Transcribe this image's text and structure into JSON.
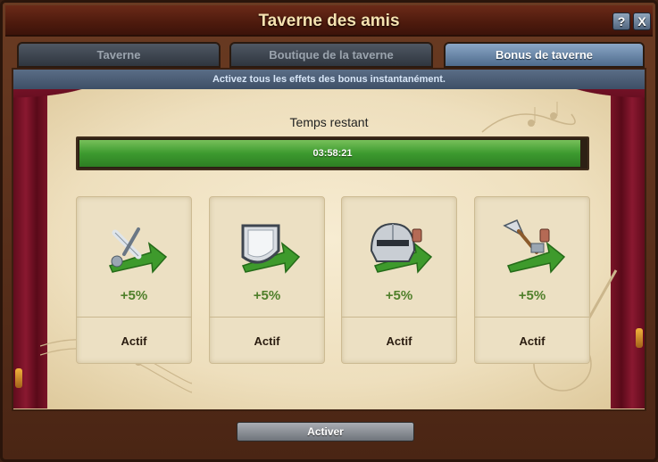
{
  "window": {
    "title": "Taverne des amis",
    "help_label": "?",
    "close_label": "X"
  },
  "tabs": [
    {
      "label": "Taverne",
      "active": false
    },
    {
      "label": "Boutique de la taverne",
      "active": false
    },
    {
      "label": "Bonus de taverne",
      "active": true
    }
  ],
  "info_text": "Activez tous les effets des bonus instantanément.",
  "timer": {
    "label": "Temps restant",
    "value": "03:58:21",
    "progress": 0.99
  },
  "bonuses": [
    {
      "icon": "sword-arrow-icon",
      "value": "+5%",
      "status": "Actif"
    },
    {
      "icon": "shield-arrow-icon",
      "value": "+5%",
      "status": "Actif"
    },
    {
      "icon": "helmet-arrow-icon",
      "value": "+5%",
      "status": "Actif"
    },
    {
      "icon": "trowel-arrow-icon",
      "value": "+5%",
      "status": "Actif"
    }
  ],
  "activate_label": "Activer",
  "colors": {
    "progress_green": "#3d9a2f",
    "bonus_green": "#4f7f2a",
    "active_tab": "#6f8fb3"
  }
}
